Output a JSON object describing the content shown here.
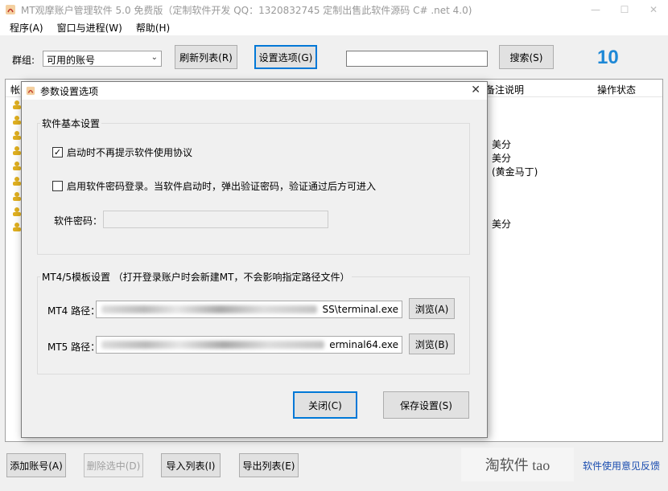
{
  "window": {
    "title": "MT观摩账户管理软件 5.0 免费版（定制软件开发 QQ：1320832745   定制出售此软件源码 C# .net 4.0)"
  },
  "menu": [
    "程序(A)",
    "窗口与进程(W)",
    "帮助(H)"
  ],
  "toolbar": {
    "group_label": "群组:",
    "group_value": "可用的账号",
    "refresh_button": "刷新列表(R)",
    "settings_button": "设置选项(G)",
    "search_value": "",
    "search_button": "搜索(S)",
    "count": "10"
  },
  "list": {
    "columns": {
      "account": "帐",
      "note": "备注说明",
      "status": "操作状态"
    },
    "notes": [
      "美分",
      "美分",
      "(黄金马丁)",
      "美分"
    ]
  },
  "bottom": {
    "add_button": "添加账号(A)",
    "delete_button": "删除选中(D)",
    "import_button": "导入列表(I)",
    "export_button": "导出列表(E)",
    "brand": "淘软件 tao",
    "feedback_link": "软件使用意见反馈"
  },
  "dialog": {
    "title": "参数设置选项",
    "basic_group": "软件基本设置",
    "check_no_agreement": {
      "label": "启动时不再提示软件使用协议",
      "checked": true
    },
    "check_password": {
      "label": "启用软件密码登录。当软件启动时，弹出验证密码，验证通过后方可进入",
      "checked": false
    },
    "password_label": "软件密码：",
    "password_value": "",
    "template_group": "MT4/5模板设置  （打开登录账户时会新建MT，不会影响指定路径文件）",
    "mt4_label": "MT4 路径：",
    "mt4_path_visible": "SS\\terminal.exe",
    "mt4_browse": "浏览(A)",
    "mt5_label": "MT5 路径：",
    "mt5_path_visible": "erminal64.exe",
    "mt5_browse": "浏览(B)",
    "close_button": "关闭(C)",
    "save_button": "保存设置(S)"
  }
}
